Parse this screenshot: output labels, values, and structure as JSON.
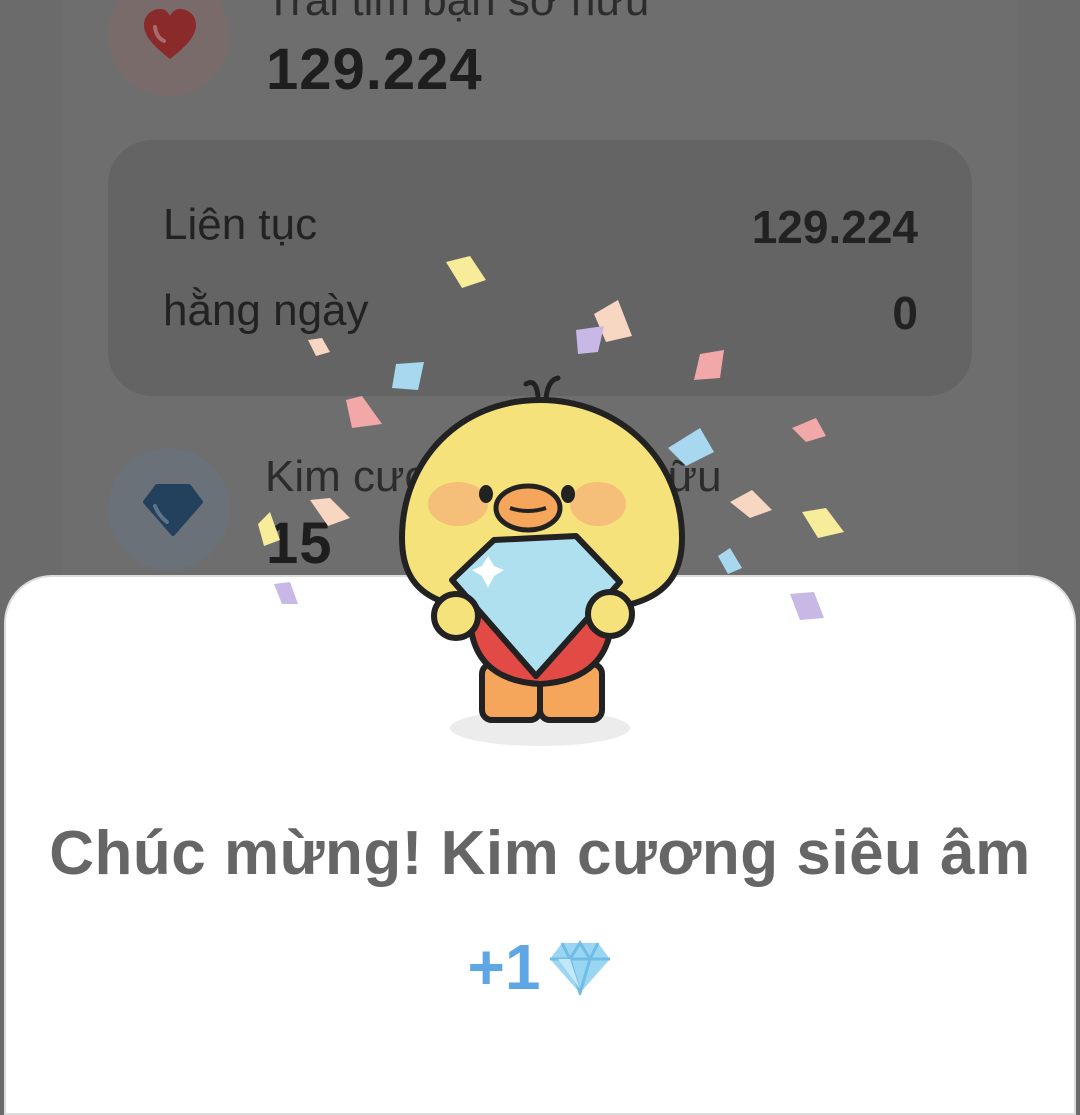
{
  "background_screen": {
    "hearts_owned_label": "Trái tim bạn sở hữu",
    "hearts_owned_value": "129.224",
    "streak_rows": [
      {
        "label": "Liên tục",
        "value": "129.224"
      },
      {
        "label": "hằng ngày",
        "value": "0"
      }
    ],
    "diamonds_owned_label": "Kim cương bạn sở hữu",
    "diamonds_owned_value": "15"
  },
  "dialog": {
    "title": "Chúc mừng! Kim cương siêu âm",
    "reward_amount": "+1",
    "reward_icon": "diamond-icon",
    "character": "duck-holding-diamond"
  },
  "colors": {
    "overlay": "#6b6b6b",
    "sheet": "#ffffff",
    "title_text": "#666666",
    "reward_text": "#5ea6e6",
    "duck_yellow": "#f6e27a",
    "diamond_blue": "#aee0f0",
    "shirt_red": "#e24a46"
  }
}
